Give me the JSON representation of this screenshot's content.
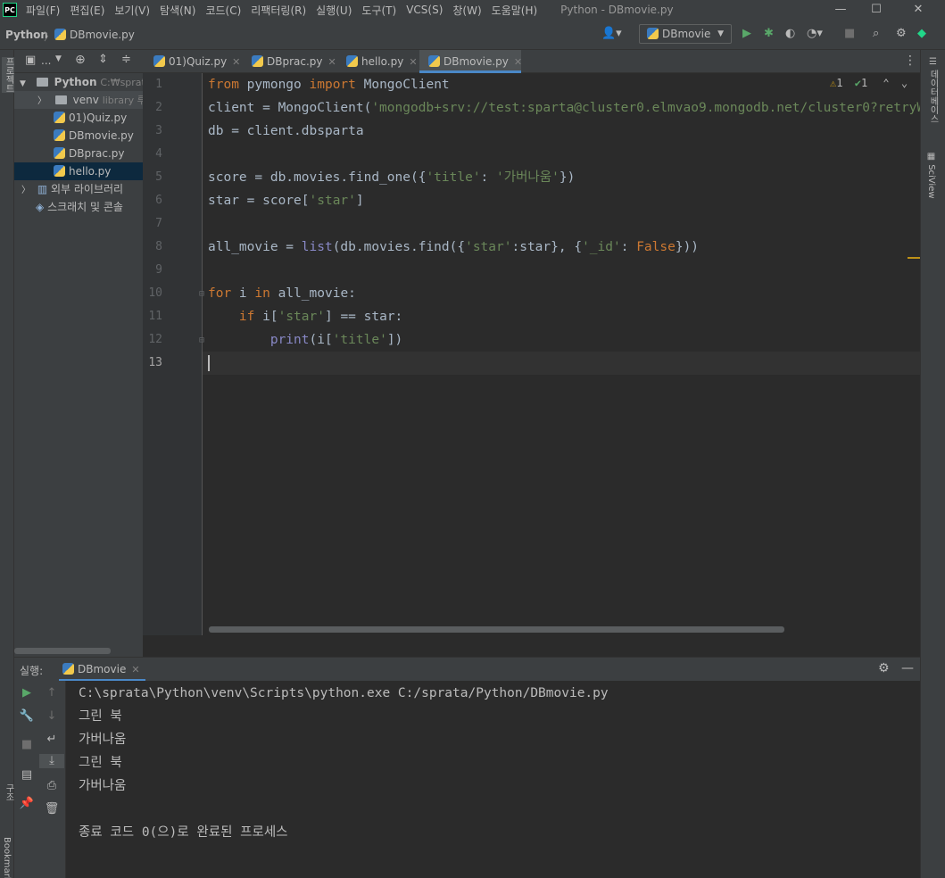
{
  "menubar": {
    "logo": "PC",
    "items": [
      "파일(F)",
      "편집(E)",
      "보기(V)",
      "탐색(N)",
      "코드(C)",
      "리팩터링(R)",
      "실행(U)",
      "도구(T)",
      "VCS(S)",
      "창(W)",
      "도움말(H)"
    ],
    "window_title": "Python - DBmovie.py"
  },
  "navbar": {
    "breadcrumb": [
      "Python",
      "DBmovie.py"
    ],
    "run_config": "DBmovie"
  },
  "left_strip": {
    "project_label": "프로젝트",
    "structure_label": "구조",
    "bookmarks_label": "Bookmarks"
  },
  "right_strip": {
    "database_label": "데이터베이스",
    "sciview_label": "SciView"
  },
  "project_tree": {
    "toolbar_label": "...",
    "root": {
      "name": "Python",
      "path": "C:₩sprata₩"
    },
    "venv": {
      "name": "venv",
      "hint": "library 루트"
    },
    "files": [
      "01)Quiz.py",
      "DBmovie.py",
      "DBprac.py",
      "hello.py"
    ],
    "external_libraries": "외부 라이브러리",
    "scratches": "스크래치 및 콘솔"
  },
  "tabs": [
    "01)Quiz.py",
    "DBprac.py",
    "hello.py",
    "DBmovie.py"
  ],
  "active_tab": "DBmovie.py",
  "inspections": {
    "warnings": "1",
    "ok": "1"
  },
  "editor": {
    "line_numbers": [
      "1",
      "2",
      "3",
      "4",
      "5",
      "6",
      "7",
      "8",
      "9",
      "10",
      "11",
      "12",
      "13"
    ],
    "lines": [
      [
        {
          "t": "from",
          "c": "kw"
        },
        {
          "t": " pymongo ",
          "c": ""
        },
        {
          "t": "import",
          "c": "kw"
        },
        {
          "t": " MongoClient",
          "c": ""
        }
      ],
      [
        {
          "t": "client = MongoClient(",
          "c": ""
        },
        {
          "t": "'mongodb+srv://test:sparta@cluster0.elmvao9.mongodb.net/cluster0?retryWrites=tr",
          "c": "str"
        }
      ],
      [
        {
          "t": "db = client.dbsparta",
          "c": ""
        }
      ],
      [],
      [
        {
          "t": "score = db.movies.find_one({",
          "c": ""
        },
        {
          "t": "'title'",
          "c": "str"
        },
        {
          "t": ": ",
          "c": ""
        },
        {
          "t": "'가버나움'",
          "c": "str"
        },
        {
          "t": "})",
          "c": ""
        }
      ],
      [
        {
          "t": "star = score[",
          "c": ""
        },
        {
          "t": "'star'",
          "c": "str"
        },
        {
          "t": "]",
          "c": ""
        }
      ],
      [],
      [
        {
          "t": "all_movie = ",
          "c": ""
        },
        {
          "t": "list",
          "c": "bi"
        },
        {
          "t": "(db.movies.find({",
          "c": ""
        },
        {
          "t": "'star'",
          "c": "str"
        },
        {
          "t": ":star}, {",
          "c": ""
        },
        {
          "t": "'_id'",
          "c": "str"
        },
        {
          "t": ": ",
          "c": ""
        },
        {
          "t": "False",
          "c": "kw"
        },
        {
          "t": "}))",
          "c": ""
        }
      ],
      [],
      [
        {
          "t": "for",
          "c": "kw"
        },
        {
          "t": " i ",
          "c": ""
        },
        {
          "t": "in",
          "c": "kw"
        },
        {
          "t": " all_movie:",
          "c": ""
        }
      ],
      [
        {
          "t": "    ",
          "c": ""
        },
        {
          "t": "if",
          "c": "kw"
        },
        {
          "t": " i[",
          "c": ""
        },
        {
          "t": "'star'",
          "c": "str"
        },
        {
          "t": "] == star:",
          "c": ""
        }
      ],
      [
        {
          "t": "        ",
          "c": ""
        },
        {
          "t": "print",
          "c": "bi"
        },
        {
          "t": "(i[",
          "c": ""
        },
        {
          "t": "'title'",
          "c": "str"
        },
        {
          "t": "])",
          "c": ""
        }
      ],
      []
    ]
  },
  "run_panel": {
    "label": "실행:",
    "tab": "DBmovie",
    "output": [
      "C:\\sprata\\Python\\venv\\Scripts\\python.exe C:/sprata/Python/DBmovie.py",
      "그린 북",
      "가버나움",
      "그린 북",
      "가버나움",
      "",
      "종료 코드 0(으)로 완료된 프로세스"
    ]
  }
}
